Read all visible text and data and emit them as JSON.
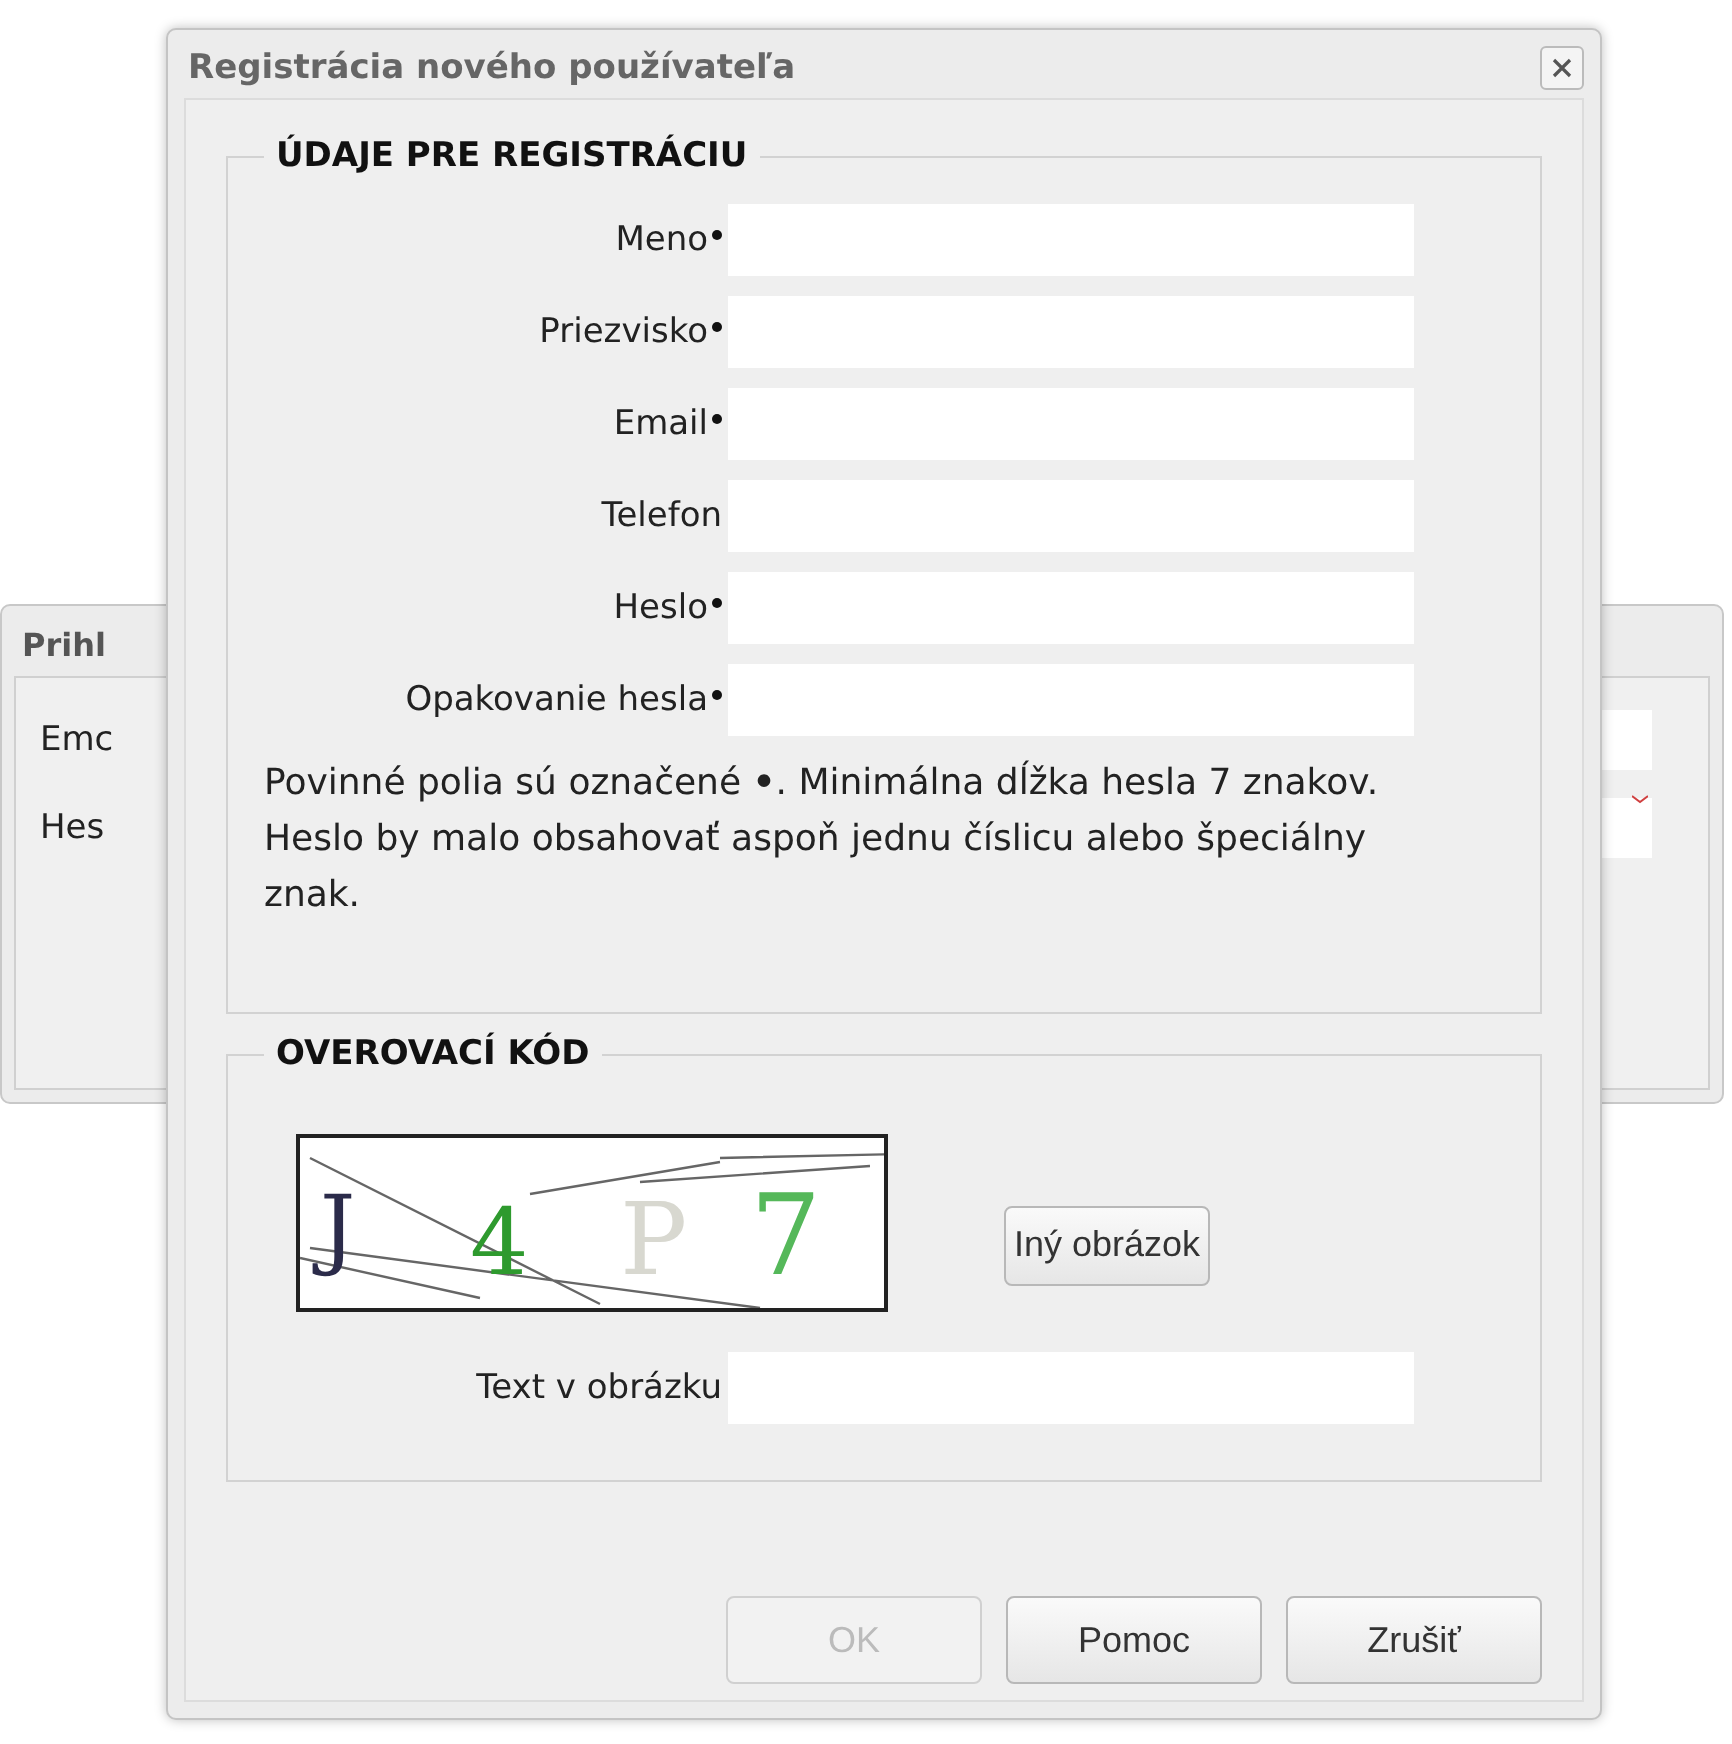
{
  "background_window": {
    "title": "Prihl",
    "labels": [
      "Emc",
      "Hes"
    ]
  },
  "dialog": {
    "title": "Registrácia nového používateľa",
    "sections": [
      {
        "legend": "ÚDAJE PRE REGISTRÁCIU",
        "fields": [
          {
            "label": "Meno",
            "required": true
          },
          {
            "label": "Priezvisko",
            "required": true
          },
          {
            "label": "Email",
            "required": true
          },
          {
            "label": "Telefon",
            "required": false
          },
          {
            "label": "Heslo",
            "required": true
          },
          {
            "label": "Opakovanie hesla",
            "required": true
          }
        ],
        "note": "Povinné polia sú označené **•**. Minimálna dĺžka hesla 7 znakov. Heslo by malo obsahovať aspoň jednu číslicu alebo špeciálny znak."
      },
      {
        "legend": "OVEROVACÍ KÓD",
        "captcha": {
          "characters": [
            {
              "char": "J",
              "color": "#2b2b4a"
            },
            {
              "char": "4",
              "color": "#2e9a2e"
            },
            {
              "char": "P",
              "color": "#d8d8d0"
            },
            {
              "char": "7",
              "color": "#55b85a"
            }
          ]
        },
        "refresh_button": "Iný obrázok",
        "fields": [
          {
            "label": "Text v obrázku",
            "required": false
          }
        ]
      }
    ],
    "buttons": [
      {
        "label": "OK",
        "disabled": true
      },
      {
        "label": "Pomoc",
        "disabled": false
      },
      {
        "label": "Zrušiť",
        "disabled": false
      }
    ]
  }
}
